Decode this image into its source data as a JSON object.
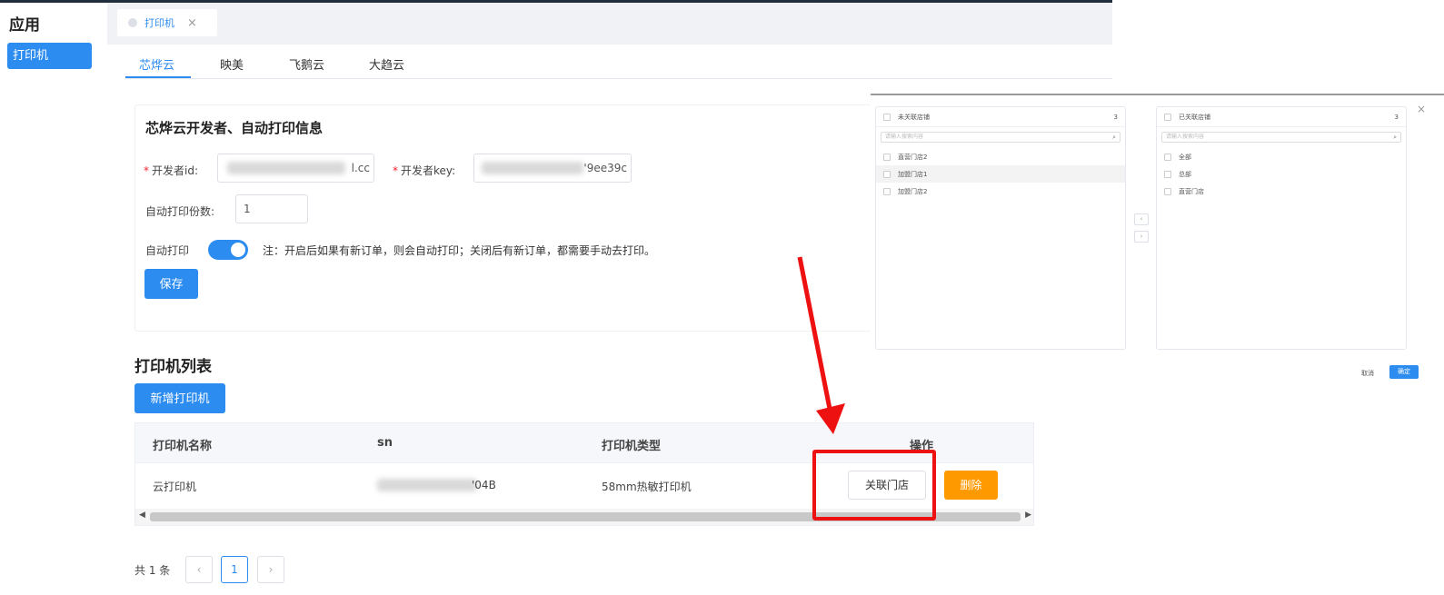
{
  "sidebar": {
    "title": "应用",
    "items": [
      {
        "label": "打印机"
      }
    ]
  },
  "page_tabs": [
    {
      "label": "打印机",
      "close": "×"
    }
  ],
  "provider_tabs": [
    {
      "label": "芯烨云",
      "active": true
    },
    {
      "label": "映美"
    },
    {
      "label": "飞鹅云"
    },
    {
      "label": "大趋云"
    }
  ],
  "config_card": {
    "title": "芯烨云开发者、自动打印信息",
    "developer_id": {
      "required_mark": "*",
      "label": "开发者id:",
      "value_visible": "l.cc"
    },
    "developer_key": {
      "required_mark": "*",
      "label": "开发者key:",
      "value_visible": "'9ee39c"
    },
    "auto_print_copies": {
      "label": "自动打印份数:",
      "value": "1"
    },
    "auto_print": {
      "label": "自动打印",
      "enabled": true,
      "note": "注：开启后如果有新订单，则会自动打印；关闭后有新订单，都需要手动去打印。"
    },
    "save_label": "保存"
  },
  "printer_list": {
    "title": "打印机列表",
    "add_label": "新增打印机",
    "columns": [
      "打印机名称",
      "sn",
      "打印机类型",
      "操作"
    ],
    "rows": [
      {
        "name": "云打印机",
        "sn_visible": "'04B",
        "type": "58mm热敏打印机",
        "link_label": "关联门店",
        "delete_label": "删除"
      }
    ]
  },
  "pager": {
    "total": "共 1 条",
    "prev": "‹",
    "current": "1",
    "next": "›"
  },
  "transfer_dialog": {
    "close": "×",
    "left": {
      "title": "未关联店铺",
      "count": "3",
      "search_placeholder": "请输入搜索内容",
      "items": [
        "直营门店2",
        "加盟门店1",
        "加盟门店2"
      ]
    },
    "right": {
      "title": "已关联店铺",
      "count": "3",
      "search_placeholder": "请输入搜索内容",
      "items": [
        "全部",
        "总部",
        "直营门店"
      ]
    },
    "move_left": "‹",
    "move_right": "›",
    "cancel_label": "取消",
    "ok_label": "确定"
  },
  "colors": {
    "primary": "#2d8cf0",
    "warning": "#ff9900",
    "highlight": "#ee1111"
  }
}
